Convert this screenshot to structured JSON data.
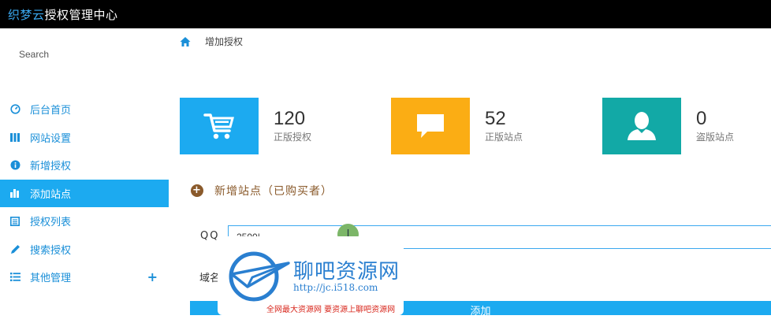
{
  "app": {
    "brand_highlight": "织梦云",
    "brand_rest": "授权管理中心"
  },
  "sidebar": {
    "search_label": "Search",
    "items": [
      {
        "label": "后台首页",
        "icon": "dashboard-icon"
      },
      {
        "label": "网站设置",
        "icon": "grid-icon"
      },
      {
        "label": "新增授权",
        "icon": "info-icon"
      },
      {
        "label": "添加站点",
        "icon": "bar-chart-icon",
        "active": true
      },
      {
        "label": "授权列表",
        "icon": "list-box-icon"
      },
      {
        "label": "搜索授权",
        "icon": "pencil-icon"
      },
      {
        "label": "其他管理",
        "icon": "list-icon",
        "expand_icon": "plus-icon"
      }
    ]
  },
  "breadcrumb": {
    "current": "增加授权"
  },
  "stats": [
    {
      "value": "120",
      "label": "正版授权",
      "color": "#1caaf0",
      "icon": "cart-icon"
    },
    {
      "value": "52",
      "label": "正版站点",
      "color": "#fbad14",
      "icon": "comment-icon"
    },
    {
      "value": "0",
      "label": "盗版站点",
      "color": "#12a9a6",
      "icon": "user-icon"
    }
  ],
  "form": {
    "title": "新增站点（已购买者）",
    "qq_label": "QQ",
    "qq_value": "2500|",
    "domain_label": "域名",
    "submit_label": "添加",
    "cursor_glyph": "I"
  },
  "watermark": {
    "title": "聊吧资源网",
    "url": "http://jc.i518.com",
    "slogan": "全网最大资源网 要资源上聊吧资源网"
  }
}
